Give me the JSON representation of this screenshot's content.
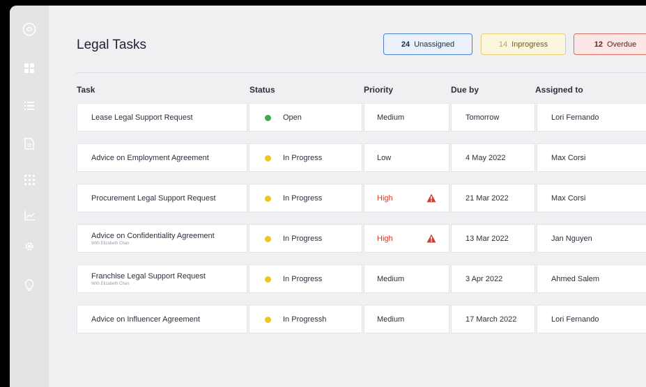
{
  "page": {
    "title": "Legal Tasks"
  },
  "sidebar": {
    "icons": [
      "logo-icon",
      "grid-icon",
      "list-icon",
      "document-icon",
      "apps-icon",
      "chart-icon",
      "gear-icon",
      "lightbulb-icon"
    ]
  },
  "summary": {
    "unassigned": {
      "count": "24",
      "label": "Unassigned"
    },
    "inprogress": {
      "count": "14",
      "label": "Inprogress"
    },
    "overdue": {
      "count": "12",
      "label": "Overdue"
    }
  },
  "columns": {
    "task": "Task",
    "status": "Status",
    "priority": "Priority",
    "due": "Due by",
    "assigned": "Assigned to"
  },
  "rows": [
    {
      "task": "Lease Legal Support Request",
      "sub": "",
      "status": "Open",
      "status_type": "open",
      "priority": "Medium",
      "flag": false,
      "due": "Tomorrow",
      "assigned": "Lori Fernando"
    },
    {
      "task": "Advice on Employment Agreement",
      "sub": "",
      "status": "In Progress",
      "status_type": "progress",
      "priority": "Low",
      "flag": false,
      "due": "4 May 2022",
      "assigned": "Max Corsi"
    },
    {
      "task": "Procurement Legal Support Request",
      "sub": "",
      "status": "In Progress",
      "status_type": "progress",
      "priority": "High",
      "flag": true,
      "due": "21 Mar 2022",
      "assigned": "Max Corsi"
    },
    {
      "task": "Advice on Confidentiality Agreement",
      "sub": "With Elizabeth Chan",
      "status": "In Progress",
      "status_type": "progress",
      "priority": "High",
      "flag": true,
      "due": "13 Mar 2022",
      "assigned": "Jan Nguyen"
    },
    {
      "task": "Franchise Legal Support Request",
      "sub": "With Elizabeth Chan",
      "status": "In Progress",
      "status_type": "progress",
      "priority": "Medium",
      "flag": false,
      "due": "3 Apr 2022",
      "assigned": "Ahmed Salem"
    },
    {
      "task": "Advice on Influencer Agreement",
      "sub": "",
      "status": "In Progressh",
      "status_type": "progress",
      "priority": "Medium",
      "flag": false,
      "due": "17 March 2022",
      "assigned": "Lori Fernando"
    }
  ],
  "colors": {
    "open": "#3faa49",
    "progress": "#eec41f",
    "high": "#d23c2f",
    "accent": "#4b7fd1"
  }
}
